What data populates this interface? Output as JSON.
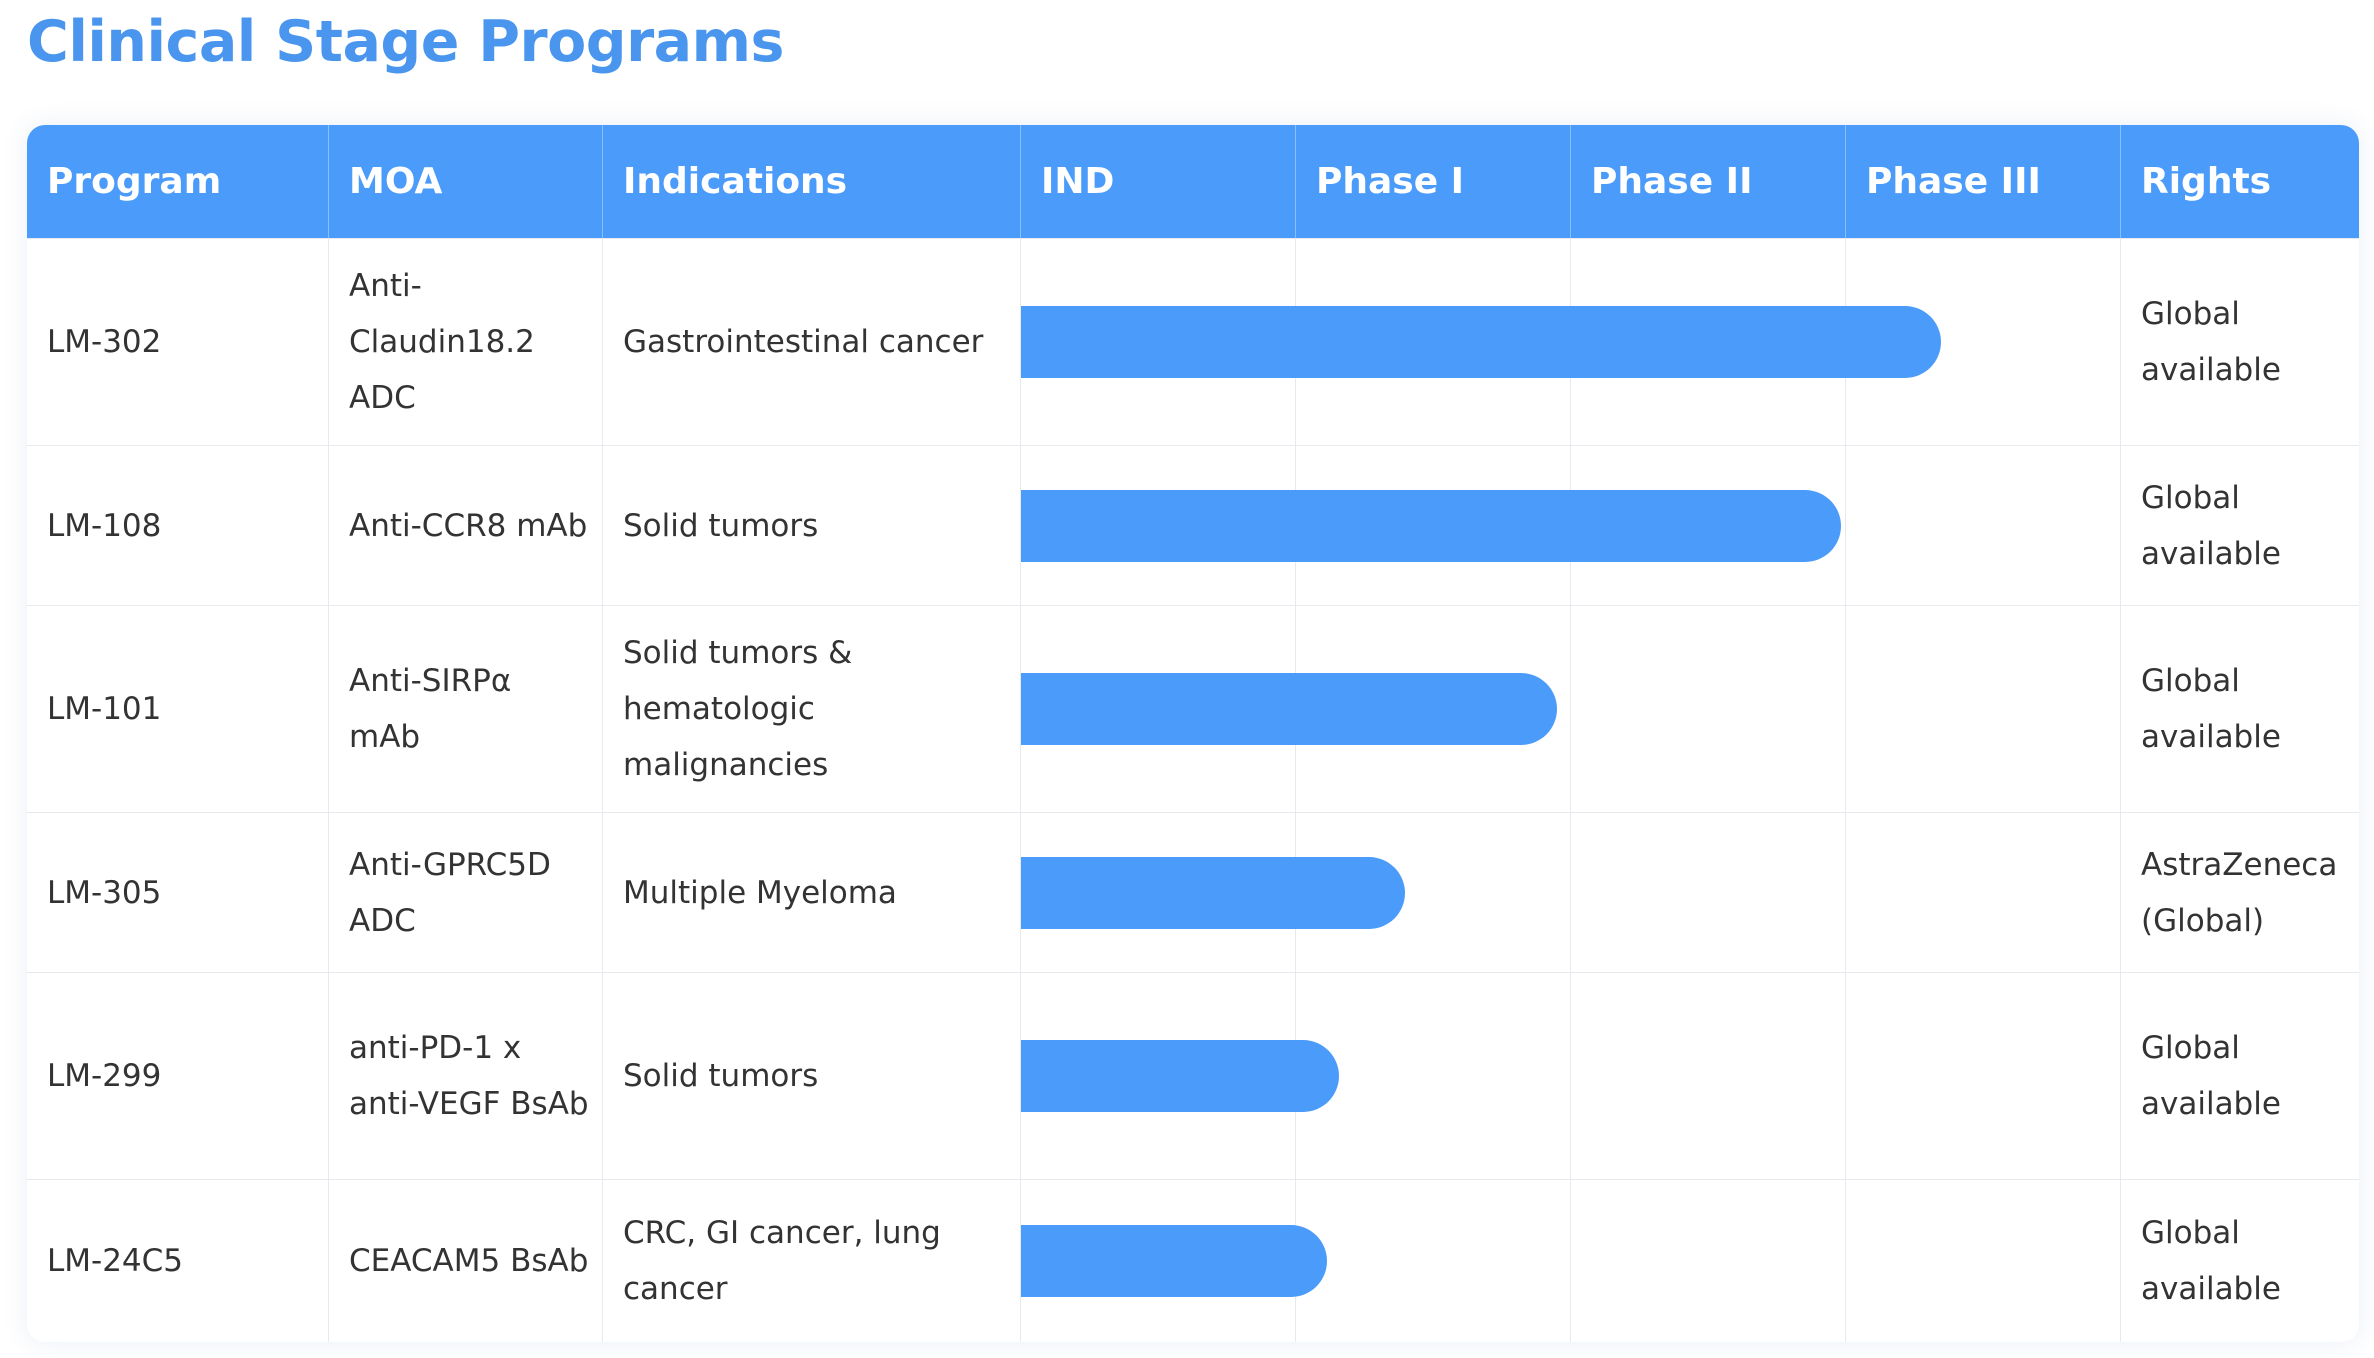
{
  "page": {
    "title": "Clinical Stage Programs"
  },
  "colors": {
    "accent": "#4b9bfa",
    "title": "#4a96ee",
    "text": "#333333",
    "border": "#e6e9ee"
  },
  "table": {
    "columns": [
      "Program",
      "MOA",
      "Indications",
      "IND",
      "Phase I",
      "Phase II",
      "Phase III",
      "Rights"
    ],
    "rows": [
      {
        "program": "LM-302",
        "moa": "Anti-Claudin18.2 ADC",
        "indications": "Gastrointestinal cancer",
        "rights": [
          "Global",
          "available"
        ],
        "progress": 0.836
      },
      {
        "program": "LM-108",
        "moa": "Anti-CCR8 mAb",
        "indications": "Solid tumors",
        "rights": [
          "Global",
          "available"
        ],
        "progress": 0.745
      },
      {
        "program": "LM-101",
        "moa": "Anti-SIRPα mAb",
        "indications": "Solid tumors & hematologic malignancies",
        "rights": [
          "Global",
          "available"
        ],
        "progress": 0.487
      },
      {
        "program": "LM-305",
        "moa": "Anti-GPRC5D ADC",
        "indications": "Multiple Myeloma",
        "rights": [
          "AstraZeneca",
          "(Global)"
        ],
        "progress": 0.349
      },
      {
        "program": "LM-299",
        "moa": "anti-PD-1 x anti-VEGF BsAb",
        "indications": "Solid tumors",
        "rights": [
          "Global",
          "available"
        ],
        "progress": 0.289
      },
      {
        "program": "LM-24C5",
        "moa": "CEACAM5 BsAb",
        "indications": "CRC, GI cancer, lung cancer",
        "rights": [
          "Global",
          "available"
        ],
        "progress": 0.278
      }
    ]
  }
}
